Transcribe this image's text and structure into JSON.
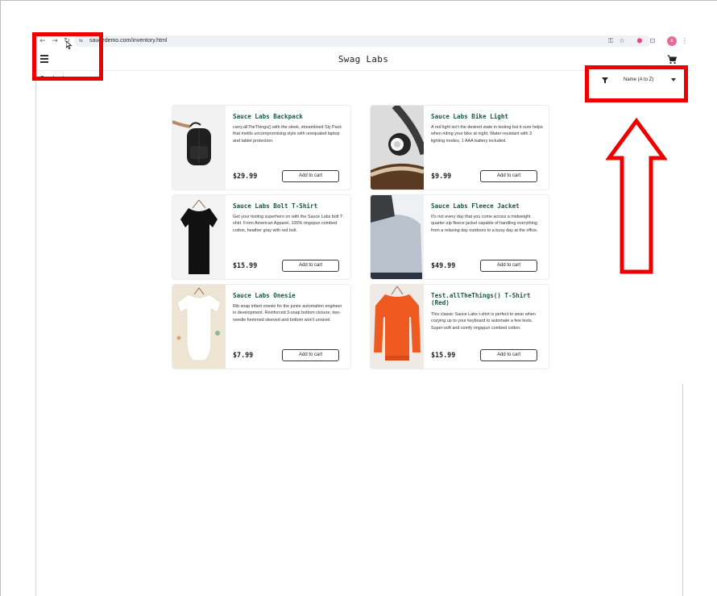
{
  "browser": {
    "url_prefix": "sau",
    "url_host": "cedemo.com",
    "url_path": "/inventory.html",
    "back_icon": "←",
    "forward_icon": "→",
    "reload_icon": "↻",
    "site_info_icon": "⇆",
    "password_icon": "⚿",
    "star_icon": "☆",
    "extension_icon": "⬢",
    "puzzle_icon": "⊡",
    "profile_initial": "s",
    "menu_icon": "⋮",
    "colors": {
      "url_pill": "#eef1f6",
      "extension": "#e84a7a",
      "profile": "#e76c9b"
    }
  },
  "app": {
    "title": "Swag Labs",
    "section_title": "Products"
  },
  "sort": {
    "selected": "Name (A to Z)"
  },
  "products": [
    {
      "name": "Sauce Labs Backpack",
      "description": "carry.allTheThings() with the sleek, streamlined Sly Pack that melds uncompromising style with unequaled laptop and tablet protection.",
      "price": "$29.99",
      "button": "Add to cart",
      "image": "backpack-image"
    },
    {
      "name": "Sauce Labs Bike Light",
      "description": "A red light isn't the desired state in testing but it sure helps when riding your bike at night. Water-resistant with 3 lighting modes, 1 AAA battery included.",
      "price": "$9.99",
      "button": "Add to cart",
      "image": "bike-light-image"
    },
    {
      "name": "Sauce Labs Bolt T-Shirt",
      "description": "Get your testing superhero on with the Sauce Labs bolt T-shirt. From American Apparel, 100% ringspun combed cotton, heather gray with red bolt.",
      "price": "$15.99",
      "button": "Add to cart",
      "image": "tshirt-image"
    },
    {
      "name": "Sauce Labs Fleece Jacket",
      "description": "It's not every day that you come across a midweight quarter-zip fleece jacket capable of handling everything from a relaxing day outdoors to a busy day at the office.",
      "price": "$49.99",
      "button": "Add to cart",
      "image": "fleece-jacket-image"
    },
    {
      "name": "Sauce Labs Onesie",
      "description": "Rib snap infant onesie for the junior automation engineer in development. Reinforced 3-snap bottom closure, two-needle hemmed sleeved and bottom won't unravel.",
      "price": "$7.99",
      "button": "Add to cart",
      "image": "onesie-image"
    },
    {
      "name": "Test.allTheThings() T-Shirt (Red)",
      "description": "This classic Sauce Labs t-shirt is perfect to wear when cozying up to your keyboard to automate a few tests. Super-soft and comfy ringspun combed cotton.",
      "price": "$15.99",
      "button": "Add to cart",
      "image": "red-sweatshirt-image"
    }
  ],
  "annotation_color": "#ef0000"
}
